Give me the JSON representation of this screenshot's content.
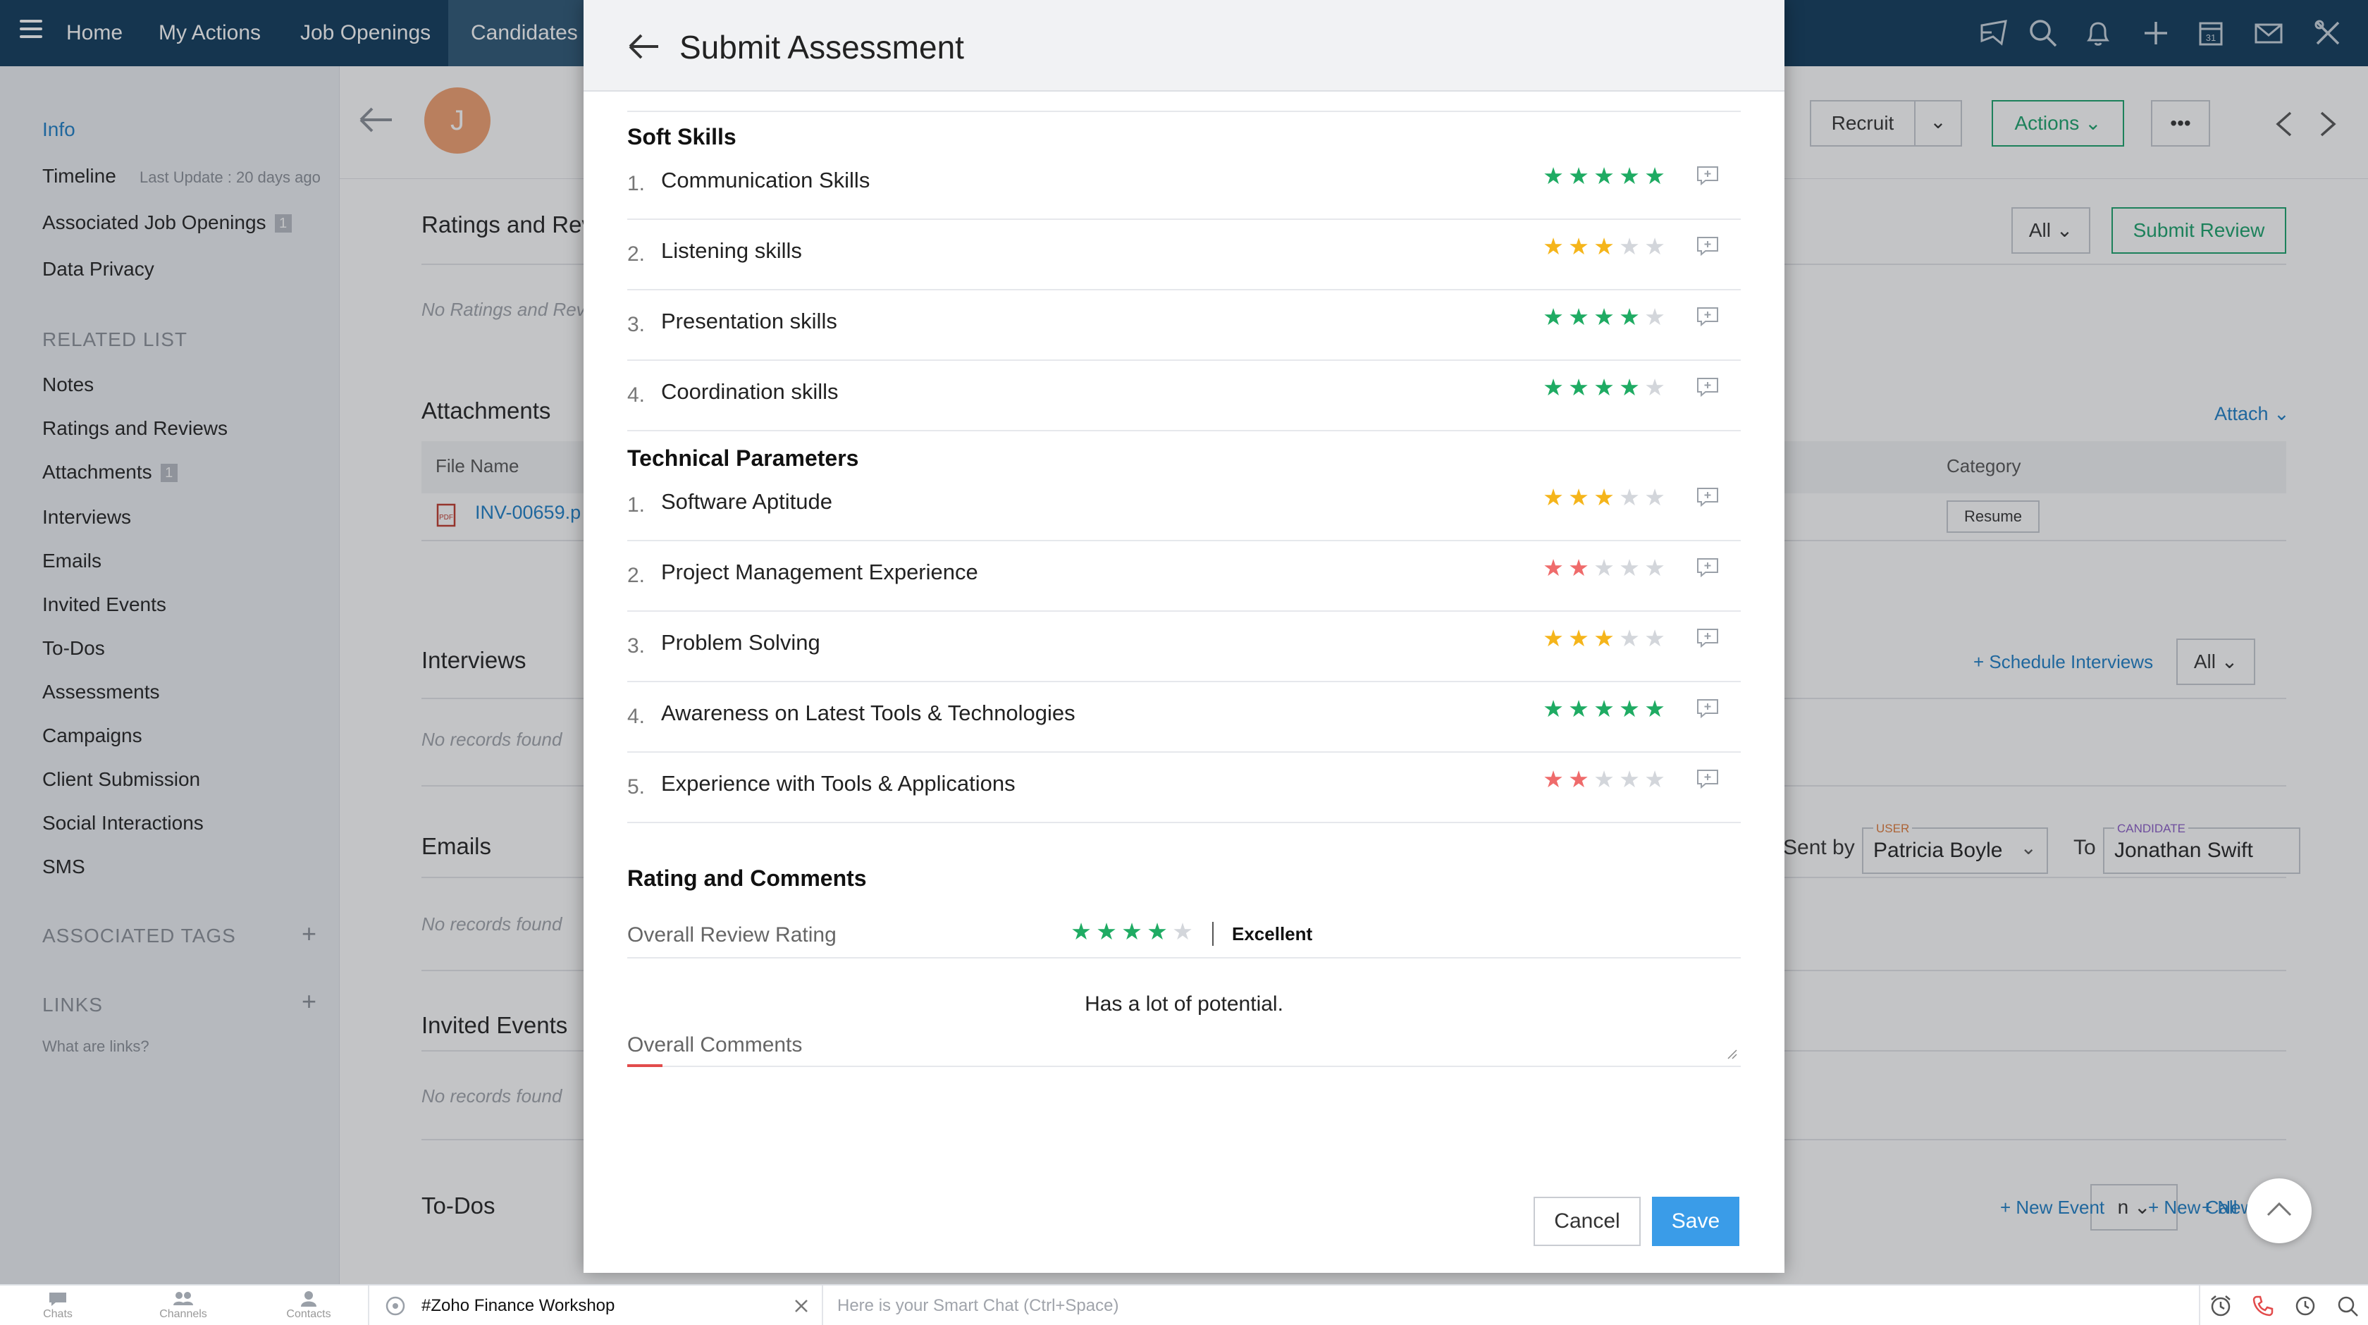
{
  "topnav": {
    "items": [
      "Home",
      "My Actions",
      "Job Openings",
      "Candidates"
    ]
  },
  "sidebar": {
    "info": "Info",
    "timeline": "Timeline",
    "last_update": "Last Update : 20 days ago",
    "associated_job_openings": "Associated Job Openings",
    "associated_job_openings_count": "1",
    "data_privacy": "Data Privacy",
    "related_list_title": "RELATED LIST",
    "related": [
      "Notes",
      "Ratings and Reviews",
      "Attachments",
      "Interviews",
      "Emails",
      "Invited Events",
      "To-Dos",
      "Assessments",
      "Campaigns",
      "Client Submission",
      "Social Interactions",
      "SMS"
    ],
    "attachments_count": "1",
    "associated_tags": "ASSOCIATED TAGS",
    "links": "LINKS",
    "what_are_links": "What are links?"
  },
  "detail": {
    "avatar_letter": "J",
    "recruit_button": "Recruit",
    "actions_button": "Actions",
    "more_button": "•••",
    "ratings_title": "Ratings and Rev",
    "ratings_filter": "All",
    "submit_review": "Submit Review",
    "no_ratings": "No Ratings and Rev",
    "attachments_title": "Attachments",
    "attach_link": "Attach",
    "file_name_header": "File Name",
    "category_header": "Category",
    "file_name": "INV-00659.p",
    "category_value": "Resume",
    "interviews_title": "Interviews",
    "schedule_interviews": "+ Schedule Interviews",
    "interviews_filter": "All",
    "no_records": "No records found",
    "emails_title": "Emails",
    "sent_by": "Sent by",
    "user_tag": "USER",
    "user_value": "Patricia Boyle",
    "to": "To",
    "candidate_tag": "CANDIDATE",
    "candidate_value": "Jonathan Swift",
    "invited_events_title": "Invited Events",
    "todos_title": "To-Dos",
    "todo_filter": "n",
    "new_task": "+ New Task",
    "new_event": "+ New Event",
    "new_call": "+ New Call"
  },
  "modal": {
    "title": "Submit Assessment",
    "groups": [
      {
        "title": "Soft Skills",
        "items": [
          {
            "num": "1.",
            "label": "Communication Skills",
            "rating": 5,
            "color": "#1fab63"
          },
          {
            "num": "2.",
            "label": "Listening skills",
            "rating": 3,
            "color": "#f5b51b"
          },
          {
            "num": "3.",
            "label": "Presentation skills",
            "rating": 4,
            "color": "#1fab63"
          },
          {
            "num": "4.",
            "label": "Coordination skills",
            "rating": 4,
            "color": "#1fab63"
          }
        ]
      },
      {
        "title": "Technical Parameters",
        "items": [
          {
            "num": "1.",
            "label": "Software Aptitude",
            "rating": 3,
            "color": "#f5b51b"
          },
          {
            "num": "2.",
            "label": "Project Management Experience",
            "rating": 2,
            "color": "#ef6b6b"
          },
          {
            "num": "3.",
            "label": "Problem Solving",
            "rating": 3,
            "color": "#f5b51b"
          },
          {
            "num": "4.",
            "label": "Awareness on Latest Tools & Technologies",
            "rating": 5,
            "color": "#1fab63"
          },
          {
            "num": "5.",
            "label": "Experience with Tools & Applications",
            "rating": 2,
            "color": "#ef6b6b"
          }
        ]
      }
    ],
    "rating_section_title": "Rating and Comments",
    "overall_rating_label": "Overall Review Rating",
    "overall_rating": 4,
    "overall_rating_color": "#1fab63",
    "overall_rating_text": "Excellent",
    "overall_comment_value": "Has a lot of potential.",
    "overall_comments_label": "Overall Comments",
    "cancel": "Cancel",
    "save": "Save"
  },
  "bottombar": {
    "chats": "Chats",
    "channels": "Channels",
    "contacts": "Contacts",
    "channel_name": "#Zoho Finance Workshop",
    "smart_chat_placeholder": "Here is your Smart Chat (Ctrl+Space)"
  }
}
